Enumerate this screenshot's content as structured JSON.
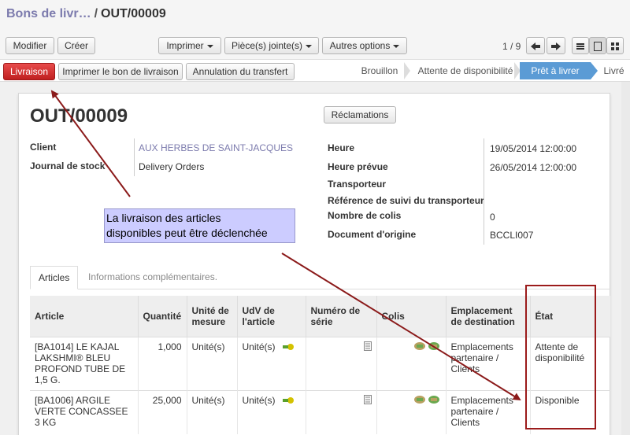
{
  "breadcrumb": {
    "parent": "Bons de livr…",
    "separator": "/",
    "current": "OUT/00009"
  },
  "toolbar": {
    "edit": "Modifier",
    "create": "Créer",
    "print": "Imprimer",
    "attachments": "Pièce(s) jointe(s)",
    "more": "Autres options",
    "pager": "1 / 9"
  },
  "actions": {
    "deliver": "Livraison",
    "print_delivery": "Imprimer le bon de livraison",
    "cancel_transfer": "Annulation du transfert"
  },
  "status": {
    "stages": [
      "Brouillon",
      "Attente de disponibilité",
      "Prêt à livrer",
      "Livré"
    ],
    "active": "Prêt à livrer"
  },
  "sheet": {
    "title": "OUT/00009",
    "claims_button": "Réclamations",
    "left_fields": [
      {
        "label": "Client",
        "value": "AUX HERBES DE SAINT-JACQUES"
      },
      {
        "label": "Journal de stock",
        "value": "Delivery Orders"
      }
    ],
    "right_fields": [
      {
        "label": "Heure",
        "value": "19/05/2014 12:00:00"
      },
      {
        "label": "Heure prévue",
        "value": "26/05/2014 12:00:00"
      },
      {
        "label": "Transporteur",
        "value": ""
      },
      {
        "label": "Référence de suivi du transporteur",
        "value": ""
      },
      {
        "label": "Nombre de colis",
        "value": "0"
      },
      {
        "label": "Document d'origine",
        "value": "BCCLI007"
      }
    ]
  },
  "annotation": {
    "line1": "La livraison des articles",
    "line2": "disponibles peut être déclenchée"
  },
  "tabs": [
    "Articles",
    "Informations complémentaires."
  ],
  "table": {
    "headers": [
      "Article",
      "Quantité",
      "Unité de mesure",
      "UdV de l'article",
      "Numéro de série",
      "Colis",
      "Emplacement de destination",
      "État"
    ],
    "rows": [
      {
        "article": "[BA1014] LE KAJAL LAKSHMI® BLEU PROFOND TUBE DE 1,5 G.",
        "quantity": "1,000",
        "uom": "Unité(s)",
        "uos": "Unité(s)",
        "location": "Emplacements partenaire / Clients",
        "state": "Attente de disponibilité"
      },
      {
        "article": "[BA1006] ARGILE VERTE CONCASSEE 3 KG",
        "quantity": "25,000",
        "uom": "Unité(s)",
        "uos": "Unité(s)",
        "location": "Emplacements partenaire / Clients",
        "state": "Disponible"
      }
    ]
  },
  "colors": {
    "accent": "#7c7bad",
    "primary_action": "#d9302c",
    "active_stage": "#5b9bd5",
    "annotation_arrow": "#8b1a1a"
  }
}
